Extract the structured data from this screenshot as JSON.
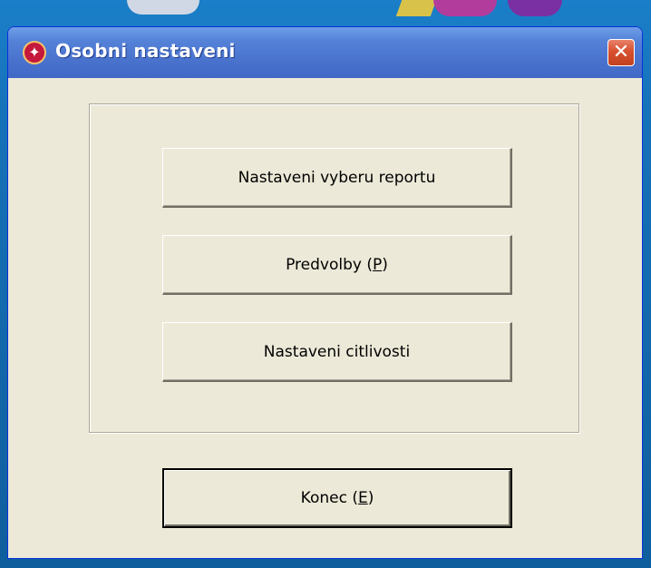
{
  "window": {
    "title": "Osobni nastaveni",
    "icon": "accessibility-icon",
    "close_glyph": "✕"
  },
  "buttons": {
    "report_selection": "Nastaveni vyberu reportu",
    "preferences_prefix": "Predvolby (",
    "preferences_key": "P",
    "preferences_suffix": ")",
    "sensitivity": "Nastaveni citlivosti",
    "exit_prefix": "Konec (",
    "exit_key": "E",
    "exit_suffix": ")"
  },
  "colors": {
    "titlebar": "#4b74cf",
    "dialog_bg": "#ece9d8",
    "close_button": "#d8502f"
  }
}
